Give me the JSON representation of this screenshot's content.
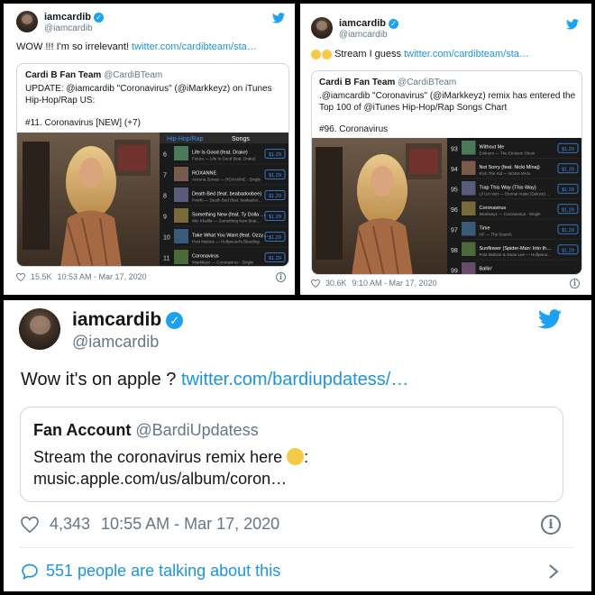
{
  "colors": {
    "link": "#1b95e0",
    "verified": "#1da1f2",
    "muted": "#657786",
    "border": "#ccd6dd"
  },
  "tweet1": {
    "name": "iamcardib",
    "handle": "@iamcardib",
    "text": "WOW !!! I'm so irrelevant! ",
    "link": "twitter.com/cardibteam/sta…",
    "quote": {
      "name": "Cardi B Fan Team",
      "handle": "@CardiBTeam",
      "body": "UPDATE: @iamcardib \"Coronavirus\" (@iMarkkeyz) on iTunes Hip-Hop/Rap US:",
      "rank": "#11. Coronavirus [NEW] (+7)"
    },
    "chart": {
      "back_label": "Hip-Hop/Rap",
      "header": "Songs",
      "rows": [
        {
          "num": "6",
          "title": "Life Is Good (feat. Drake)",
          "sub": "Future — Life Is Good (feat. Drake)",
          "price": "$1.29"
        },
        {
          "num": "7",
          "title": "ROXANNE",
          "sub": "Arizona Zervas — ROXANNE - Single",
          "price": "$1.29"
        },
        {
          "num": "8",
          "title": "Death Bed (feat. beabadoobee)",
          "sub": "Powfu — Death Bed (feat. beabadoo…",
          "price": "$1.29"
        },
        {
          "num": "9",
          "title": "Something New (feat. Ty Dolla $ign)",
          "sub": "Wiz Khalifa — Something New (feat.…",
          "price": "$1.29"
        },
        {
          "num": "10",
          "title": "Take What You Want (feat. Ozzy Osbourne & Travis Scott)",
          "sub": "Post Malone — Hollywood's Bleeding",
          "price": "$1.29"
        },
        {
          "num": "11",
          "title": "Coronavirus",
          "sub": "iMarkkeyz — Coronavirus - Single",
          "price": "$1.29"
        }
      ]
    },
    "likes": "15.5K",
    "timestamp": "10:53 AM - Mar 17, 2020"
  },
  "tweet2": {
    "name": "iamcardib",
    "handle": "@iamcardib",
    "text": "Stream I guess ",
    "link": "twitter.com/cardibteam/sta…",
    "emoji": [
      "weary-face",
      "grinning-sweat-face"
    ],
    "quote": {
      "name": "Cardi B Fan Team",
      "handle": "@CardiBTeam",
      "body": ".@iamcardib \"Coronavirus\" (@iMarkkeyz) remix has entered the Top 100 of @iTunes Hip-Hop/Rap Songs Chart",
      "rank": "#96. Coronavirus"
    },
    "chart": {
      "rows": [
        {
          "num": "93",
          "title": "Without Me",
          "sub": "Eminem — The Eminem Show",
          "price": "$1.29"
        },
        {
          "num": "94",
          "title": "Not Sorry (feat. Nicki Minaj)",
          "sub": "Rich The Kid — BOSS MAN",
          "price": "$1.29"
        },
        {
          "num": "95",
          "title": "Trap This Way (This Way)",
          "sub": "Lil Uzi Vert — Eternal Atake (Deluxe)…",
          "price": "$1.29"
        },
        {
          "num": "96",
          "title": "Coronavirus",
          "sub": "iMarkkeyz — Coronavirus - Single",
          "price": "$1.29"
        },
        {
          "num": "97",
          "title": "Time",
          "sub": "NF — The Search",
          "price": "$1.29"
        },
        {
          "num": "98",
          "title": "Sunflower (Spider-Man: Into the Spider-Verse)",
          "sub": "Post Malone & Swae Lee — Hollywoo…",
          "price": "$1.29"
        },
        {
          "num": "99",
          "title": "Ballin'",
          "sub": "",
          "price": ""
        }
      ]
    },
    "likes": "30.6K",
    "timestamp": "9:10 AM - Mar 17, 2020"
  },
  "tweet3": {
    "name": "iamcardib",
    "handle": "@iamcardib",
    "text": "Wow it's on apple ? ",
    "link": "twitter.com/bardiupdatess/…",
    "quote": {
      "name": "Fan Account",
      "handle": "@BardiUpdatess",
      "body_line1": "Stream the coronavirus remix here ",
      "body_line2": "music.apple.com/us/album/coron…",
      "emoji": "face-with-tears-of-joy"
    },
    "likes": "4,343",
    "timestamp": "10:55 AM - Mar 17, 2020",
    "talking": "551 people are talking about this"
  }
}
